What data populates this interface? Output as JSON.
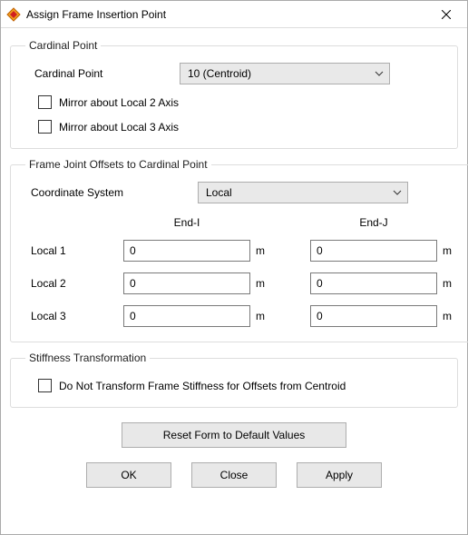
{
  "window": {
    "title": "Assign Frame Insertion Point"
  },
  "groups": {
    "cardinal": {
      "legend": "Cardinal Point",
      "label": "Cardinal Point",
      "select": "10  (Centroid)",
      "mirror2": "Mirror about Local 2 Axis",
      "mirror3": "Mirror about Local 3 Axis"
    },
    "offsets": {
      "legend": "Frame Joint Offsets to Cardinal Point",
      "coord_label": "Coordinate System",
      "coord_select": "Local",
      "hdr_i": "End-I",
      "hdr_j": "End-J",
      "rows": {
        "local1": {
          "label": "Local 1",
          "i": "0",
          "j": "0",
          "unit": "m"
        },
        "local2": {
          "label": "Local 2",
          "i": "0",
          "j": "0",
          "unit": "m"
        },
        "local3": {
          "label": "Local 3",
          "i": "0",
          "j": "0",
          "unit": "m"
        }
      }
    },
    "stiffness": {
      "legend": "Stiffness Transformation",
      "do_not_transform": "Do Not Transform Frame Stiffness for Offsets from Centroid"
    }
  },
  "buttons": {
    "reset": "Reset Form to Default Values",
    "ok": "OK",
    "close": "Close",
    "apply": "Apply"
  }
}
